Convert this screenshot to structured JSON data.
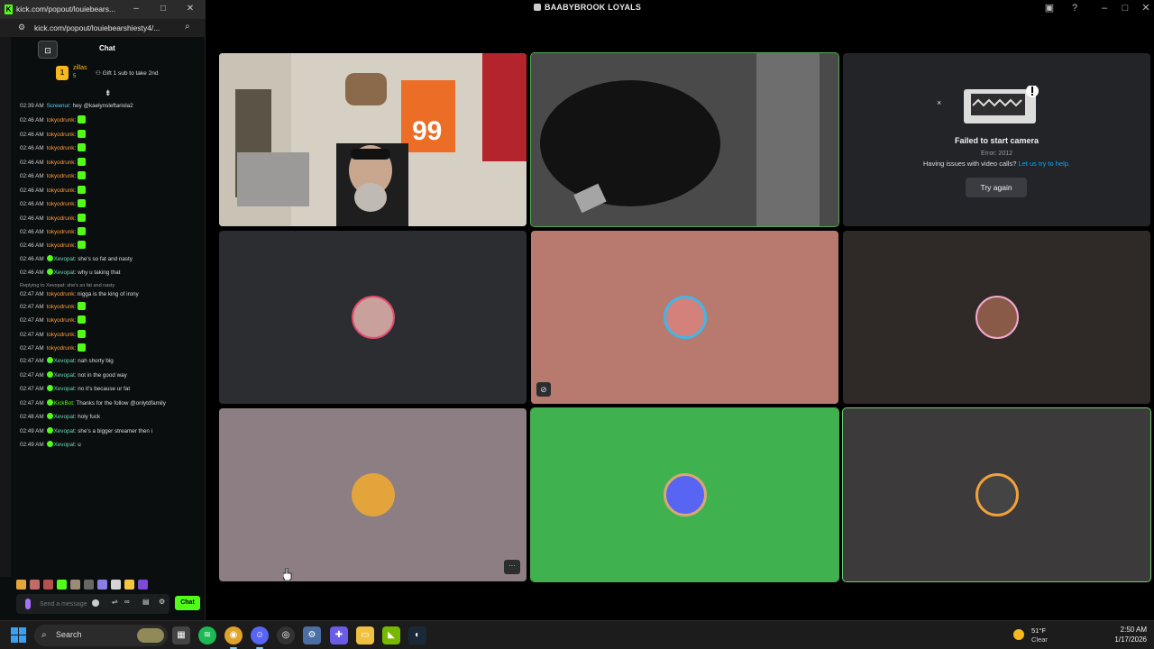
{
  "discord": {
    "title": "BAABYBROOK LOYALS",
    "tiles": [
      {
        "name": "tile-cam1",
        "type": "camera"
      },
      {
        "name": "tile-cam2",
        "type": "camera"
      },
      {
        "name": "tile-failed",
        "type": "error"
      },
      {
        "name": "tile-user4",
        "bg": "#2b2d31"
      },
      {
        "name": "tile-user5",
        "bg": "#b87a6e"
      },
      {
        "name": "tile-user6",
        "bg": "#2f2a28"
      },
      {
        "name": "tile-user7",
        "bg": "#8d7e83"
      },
      {
        "name": "tile-user8",
        "bg": "#3fb24f"
      },
      {
        "name": "tile-user9",
        "bg": "#3c3a3a"
      }
    ],
    "failed_camera": {
      "title": "Failed to start camera",
      "error": "Error: 2012",
      "issue_text": "Having issues with video calls?",
      "issue_link": "Let us try to help.",
      "button": "Try again"
    }
  },
  "kick": {
    "tab_title": "kick.com/popout/louiebears...",
    "url": "kick.com/popout/louiebearshiesty4/...",
    "chat_label": "Chat",
    "gift": {
      "rank": "1",
      "user": "zillas",
      "count": "5",
      "text": "Gift 1 sub to take 2nd"
    },
    "messages": [
      {
        "ts": "02:39 AM",
        "user": "Screenur",
        "color": "u-blue",
        "text": "hey @kaelynsleftariola2",
        "emote": false
      },
      {
        "ts": "02:46 AM",
        "user": "tokyodrunk",
        "color": "u-orange",
        "text": "",
        "emote": true
      },
      {
        "ts": "02:46 AM",
        "user": "tokyodrunk",
        "color": "u-orange",
        "text": "",
        "emote": true
      },
      {
        "ts": "02:46 AM",
        "user": "tokyodrunk",
        "color": "u-orange",
        "text": "",
        "emote": true
      },
      {
        "ts": "02:46 AM",
        "user": "tokyodrunk",
        "color": "u-orange",
        "text": "",
        "emote": true
      },
      {
        "ts": "02:46 AM",
        "user": "tokyodrunk",
        "color": "u-orange",
        "text": "",
        "emote": true
      },
      {
        "ts": "02:46 AM",
        "user": "tokyodrunk",
        "color": "u-orange",
        "text": "",
        "emote": true
      },
      {
        "ts": "02:46 AM",
        "user": "tokyodrunk",
        "color": "u-orange",
        "text": "",
        "emote": true
      },
      {
        "ts": "02:46 AM",
        "user": "tokyodrunk",
        "color": "u-orange",
        "text": "",
        "emote": true
      },
      {
        "ts": "02:46 AM",
        "user": "tokyodrunk",
        "color": "u-orange",
        "text": "",
        "emote": true
      },
      {
        "ts": "02:46 AM",
        "user": "tokyodrunk",
        "color": "u-orange",
        "text": "",
        "emote": true
      },
      {
        "ts": "02:46 AM",
        "user": "Xevopat",
        "color": "u-teal",
        "text": "she's so fat and nasty",
        "emote": false,
        "badge": true
      },
      {
        "ts": "02:46 AM",
        "user": "Xevopat",
        "color": "u-teal",
        "text": "why u taking that",
        "emote": false,
        "badge": true
      },
      {
        "reply": "Replying to Xevopat: she's so fat and nasty",
        "ts": "02:47 AM",
        "user": "tokyodrunk",
        "color": "u-orange",
        "text": "nigga is the king of irony",
        "emote": false
      },
      {
        "ts": "02:47 AM",
        "user": "tokyodrunk",
        "color": "u-orange",
        "text": "",
        "emote": true
      },
      {
        "ts": "02:47 AM",
        "user": "tokyodrunk",
        "color": "u-orange",
        "text": "",
        "emote": true
      },
      {
        "ts": "02:47 AM",
        "user": "tokyodrunk",
        "color": "u-orange",
        "text": "",
        "emote": true
      },
      {
        "ts": "02:47 AM",
        "user": "tokyodrunk",
        "color": "u-orange",
        "text": "",
        "emote": true
      },
      {
        "ts": "02:47 AM",
        "user": "Xevopat",
        "color": "u-teal",
        "text": "nah shorty big",
        "emote": false,
        "badge": true
      },
      {
        "ts": "02:47 AM",
        "user": "Xevopat",
        "color": "u-teal",
        "text": "not in the good way",
        "emote": false,
        "badge": true
      },
      {
        "ts": "02:47 AM",
        "user": "Xevopat",
        "color": "u-teal",
        "text": "no it's because ur fat",
        "emote": false,
        "badge": true
      },
      {
        "ts": "02:47 AM",
        "user": "KickBot",
        "color": "u-kb",
        "text": "Thanks for the follow @onlytdfamily",
        "emote": false,
        "badge": true
      },
      {
        "ts": "02:48 AM",
        "user": "Xevopat",
        "color": "u-teal",
        "text": "holy fuck",
        "emote": false,
        "badge": true
      },
      {
        "ts": "02:49 AM",
        "user": "Xevopat",
        "color": "u-teal",
        "text": "she's a bigger streamer then i",
        "emote": false,
        "badge": true
      },
      {
        "ts": "02:49 AM",
        "user": "Xevopat",
        "color": "u-teal",
        "text": "u",
        "emote": false,
        "badge": true
      }
    ],
    "input_placeholder": "Send a message",
    "send_label": "Chat"
  },
  "taskbar": {
    "search_label": "Search",
    "weather_temp": "51°F",
    "weather_cond": "Clear",
    "time": "2:50 AM",
    "date": "1/17/2026"
  }
}
